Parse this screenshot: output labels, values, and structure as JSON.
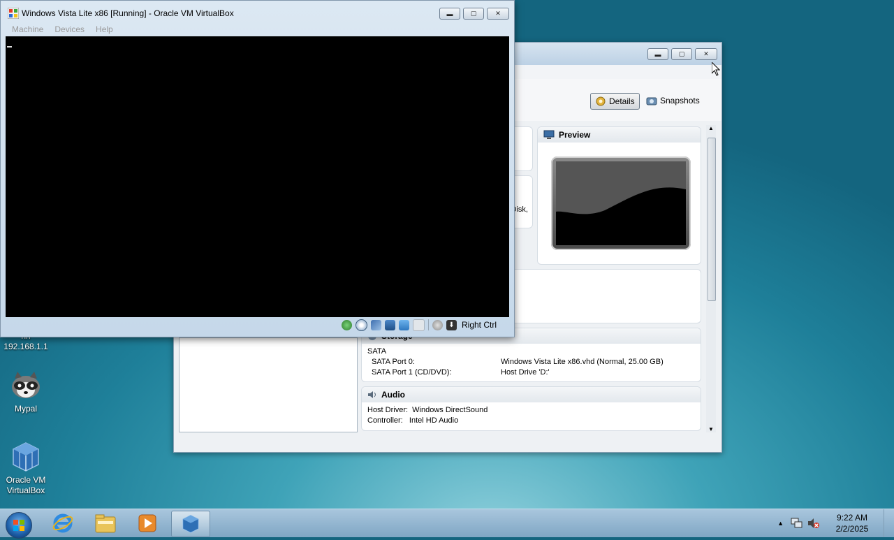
{
  "desktop": {
    "icons": [
      {
        "label": "nn\n192.168.1.1",
        "line1": "nn",
        "line2": "192.168.1.1"
      },
      {
        "label": "Mypal"
      },
      {
        "label": "Oracle VM VirtualBox",
        "line1": "Oracle VM",
        "line2": "VirtualBox"
      }
    ]
  },
  "vm_window": {
    "title": "Windows Vista Lite x86 [Running] - Oracle VM VirtualBox",
    "menu": [
      "Machine",
      "Devices",
      "Help"
    ],
    "status": {
      "host_key": "Right Ctrl"
    }
  },
  "manager": {
    "toolbar": {
      "details": "Details",
      "snapshots": "Snapshots"
    },
    "preview": {
      "header": "Preview"
    },
    "partial_text": "Disk,",
    "storage": {
      "header": "Storage",
      "controller": "SATA",
      "rows": [
        {
          "k": "SATA Port 0:",
          "v": "Windows Vista Lite x86.vhd (Normal, 25.00 GB)"
        },
        {
          "k": "SATA Port 1 (CD/DVD):",
          "v": "Host Drive 'D:'"
        }
      ]
    },
    "audio": {
      "header": "Audio",
      "host_driver": "Host Driver:  Windows DirectSound",
      "controller": "Controller:   Intel HD Audio"
    }
  },
  "taskbar": {
    "apps": [
      "internet-explorer",
      "windows-explorer",
      "windows-media-player",
      "virtualbox"
    ],
    "clock": {
      "time": "9:22 AM",
      "date": "2/2/2025"
    }
  }
}
